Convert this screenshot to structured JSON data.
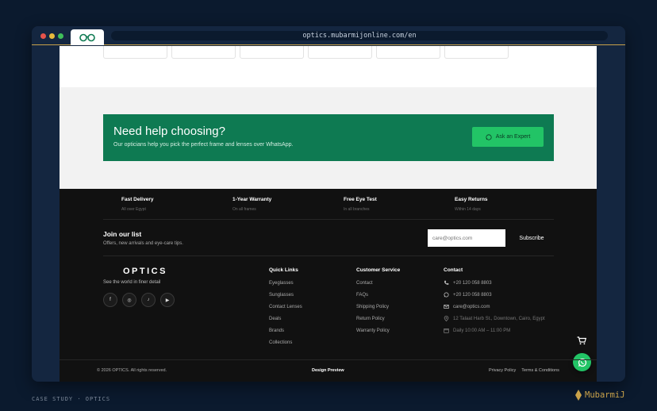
{
  "browser": {
    "url": "optics.mubarmijonline.com/en",
    "dots": [
      "#e5534b",
      "#e7b93c",
      "#3fbf5a"
    ]
  },
  "help_banner": {
    "title": "Need help choosing?",
    "subtitle": "Our opticians help you pick the perfect frame and lenses over WhatsApp.",
    "button_label": "Ask an Expert"
  },
  "features": [
    {
      "title": "Fast Delivery",
      "subtitle": "All over Egypt"
    },
    {
      "title": "1-Year Warranty",
      "subtitle": "On all frames"
    },
    {
      "title": "Free Eye Test",
      "subtitle": "In all branches"
    },
    {
      "title": "Easy Returns",
      "subtitle": "Within 14 days"
    }
  ],
  "newsletter": {
    "title": "Join our list",
    "subtitle": "Offers, new arrivals and eye-care tips.",
    "email_placeholder": "care@optics.com",
    "subscribe_label": "Subscribe"
  },
  "brand": {
    "name": "OPTICS",
    "tagline": "See the world in finer detail",
    "socials": [
      "f",
      "◎",
      "♪",
      "▶"
    ]
  },
  "quick_links": {
    "heading": "Quick Links",
    "items": [
      "Eyeglasses",
      "Sunglasses",
      "Contact Lenses",
      "Deals",
      "Brands",
      "Collections"
    ]
  },
  "customer_service": {
    "heading": "Customer Service",
    "items": [
      "Contact",
      "FAQs",
      "Shipping Policy",
      "Return Policy",
      "Warranty Policy"
    ]
  },
  "contact": {
    "heading": "Contact",
    "items": [
      {
        "icon": "phone-icon",
        "text": "+20 120 058 8803"
      },
      {
        "icon": "whatsapp-icon",
        "text": "+20 120 058 8803"
      },
      {
        "icon": "mail-icon",
        "text": "care@optics.com"
      },
      {
        "icon": "location-icon",
        "text": "12 Talaat Harb St., Downtown, Cairo, Egypt"
      },
      {
        "icon": "calendar-icon",
        "text": "Daily 10:00 AM – 11:00 PM"
      }
    ]
  },
  "bottom_bar": {
    "copyright": "© 2026 OPTICS. All rights reserved.",
    "design_label": "Design Preview",
    "privacy": "Privacy Policy",
    "terms": "Terms & Conditions"
  },
  "page_caption": "CASE STUDY · OPTICS",
  "signature": "MubarmiJ",
  "colors": {
    "accent_gold": "#c9a24a",
    "banner_green": "#0e7a52",
    "whatsapp_green": "#22c466",
    "footer_bg": "#111111"
  }
}
